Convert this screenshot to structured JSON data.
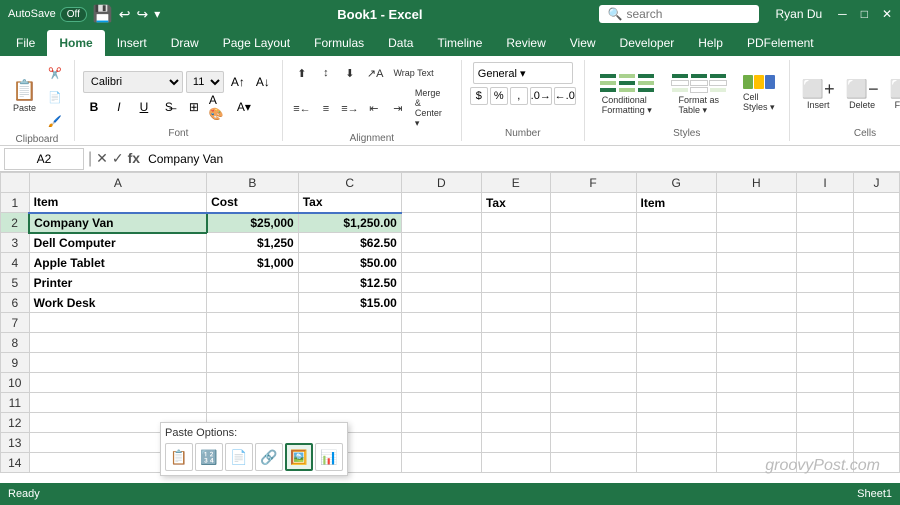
{
  "titleBar": {
    "autosave": "AutoSave",
    "autosaveState": "Off",
    "title": "Book1 - Excel",
    "user": "Ryan Du",
    "searchPlaceholder": "search"
  },
  "ribbonTabs": [
    "File",
    "Home",
    "Insert",
    "Draw",
    "Page Layout",
    "Formulas",
    "Data",
    "Timeline",
    "Review",
    "View",
    "Developer",
    "Help",
    "PDFelement"
  ],
  "activeTab": "Home",
  "ribbon": {
    "clipboard": {
      "label": "Clipboard",
      "paste": "Paste"
    },
    "font": {
      "label": "Font",
      "fontName": "Calibri",
      "fontSize": "11",
      "bold": "B",
      "italic": "I",
      "underline": "U"
    },
    "alignment": {
      "label": "Alignment",
      "wrapText": "Wrap Text",
      "mergeCenter": "Merge & Center"
    },
    "number": {
      "label": "Number",
      "format": "General"
    },
    "styles": {
      "label": "Styles"
    },
    "cells": {
      "label": "Cells",
      "insert": "Insert",
      "delete": "Delete",
      "format": "Format"
    }
  },
  "formulaBar": {
    "nameBox": "A2",
    "formula": "Company Van"
  },
  "columns": [
    "",
    "A",
    "B",
    "C",
    "D",
    "E",
    "F",
    "G",
    "H",
    "I",
    "J"
  ],
  "rows": [
    {
      "num": 1,
      "cells": [
        "Item",
        "Cost",
        "Tax",
        "",
        "Tax",
        "",
        "Item",
        "",
        "",
        ""
      ]
    },
    {
      "num": 2,
      "cells": [
        "Company Van",
        "$25,000",
        "$1,250.00",
        "",
        "",
        "",
        "",
        "",
        "",
        ""
      ]
    },
    {
      "num": 3,
      "cells": [
        "Dell Computer",
        "$1,250",
        "$62.50",
        "",
        "",
        "",
        "",
        "",
        "",
        ""
      ]
    },
    {
      "num": 4,
      "cells": [
        "Apple Tablet",
        "$1,000",
        "$50.00",
        "",
        "",
        "",
        "",
        "",
        "",
        ""
      ]
    },
    {
      "num": 5,
      "cells": [
        "Printer",
        "",
        "$12.50",
        "",
        "",
        "",
        "",
        "",
        "",
        ""
      ]
    },
    {
      "num": 6,
      "cells": [
        "Work Desk",
        "",
        "$15.00",
        "",
        "",
        "",
        "",
        "",
        "",
        ""
      ]
    },
    {
      "num": 7,
      "cells": [
        "",
        "",
        "",
        "",
        "",
        "",
        "",
        "",
        "",
        ""
      ]
    },
    {
      "num": 8,
      "cells": [
        "",
        "",
        "",
        "",
        "",
        "",
        "",
        "",
        "",
        ""
      ]
    },
    {
      "num": 9,
      "cells": [
        "",
        "",
        "",
        "",
        "",
        "",
        "",
        "",
        "",
        ""
      ]
    },
    {
      "num": 10,
      "cells": [
        "",
        "",
        "",
        "",
        "",
        "",
        "",
        "",
        "",
        ""
      ]
    },
    {
      "num": 11,
      "cells": [
        "",
        "",
        "",
        "",
        "",
        "",
        "",
        "",
        "",
        ""
      ]
    },
    {
      "num": 12,
      "cells": [
        "",
        "",
        "",
        "",
        "",
        "",
        "",
        "",
        "",
        ""
      ]
    },
    {
      "num": 13,
      "cells": [
        "",
        "",
        "",
        "",
        "",
        "",
        "",
        "",
        "",
        ""
      ]
    },
    {
      "num": 14,
      "cells": [
        "",
        "",
        "",
        "",
        "",
        "",
        "",
        "",
        "",
        ""
      ]
    }
  ],
  "pasteOptions": {
    "label": "Paste Options:",
    "buttons": [
      "📋",
      "🔢",
      "📄",
      "🔗",
      "🖼️",
      "📊"
    ]
  },
  "watermark": "groovyPost.com",
  "statusBar": {
    "mode": "Ready",
    "sheetName": "Sheet1"
  }
}
